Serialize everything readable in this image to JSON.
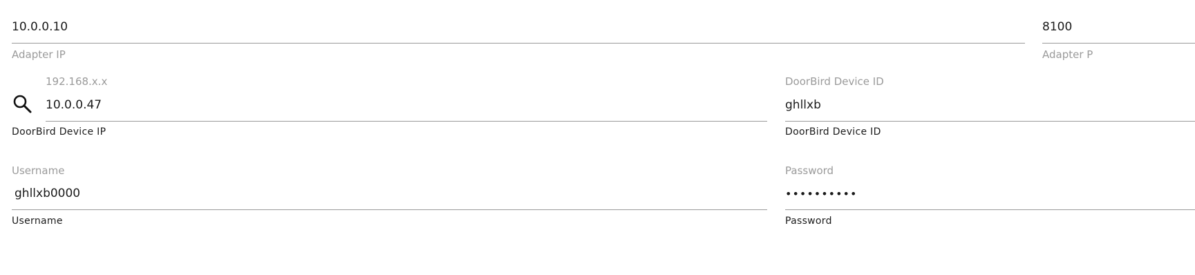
{
  "adapter_ip": {
    "value": "10.0.0.10",
    "helper": "Adapter IP"
  },
  "adapter_port": {
    "value": "8100",
    "helper": "Adapter P"
  },
  "device_ip": {
    "placeholder": "192.168.x.x",
    "value": "10.0.0.47",
    "caption": "DoorBird Device IP",
    "icon": "search-icon"
  },
  "device_id": {
    "label": "DoorBird Device ID",
    "value": "ghllxb",
    "caption": "DoorBird Device ID"
  },
  "username": {
    "label": "Username",
    "value": "ghllxb0000",
    "caption": "Username"
  },
  "password": {
    "label": "Password",
    "value": "••••••••••",
    "caption": "Password"
  },
  "colors": {
    "underline": "#9a9a9a",
    "hint": "#9a9a9a",
    "text": "#1a1a1a"
  }
}
